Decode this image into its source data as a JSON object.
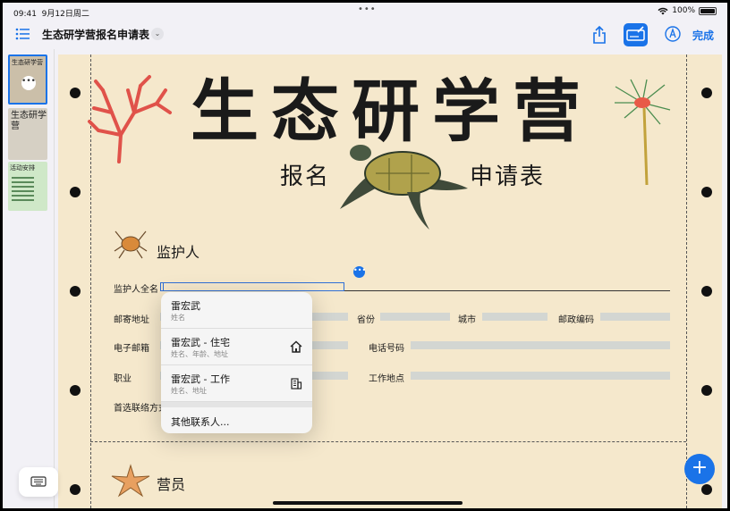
{
  "status": {
    "time": "09:41",
    "date": "9月12日周二",
    "battery": "100%"
  },
  "toolbar": {
    "title": "生态研学营报名申请表",
    "done_label": "完成"
  },
  "sidebar": {
    "thumbs": [
      {
        "label": "生态研学营"
      },
      {
        "label": "生态研学营"
      },
      {
        "label": "活动安排"
      }
    ]
  },
  "doc": {
    "title": "生态研学营",
    "subtitle_left": "报名",
    "subtitle_right": "申请表",
    "guardian": {
      "heading": "监护人",
      "full_name": "监护人全名",
      "mailing_address": "邮寄地址",
      "province": "省份",
      "city": "城市",
      "postal_code": "邮政编码",
      "email": "电子邮箱",
      "phone": "电话号码",
      "occupation": "职业",
      "workplace": "工作地点",
      "preferred_contact": "首选联络方式"
    },
    "camper": {
      "heading": "营员"
    }
  },
  "autofill": {
    "items": [
      {
        "name": "雷宏武",
        "detail": "姓名",
        "icon": "none"
      },
      {
        "name": "雷宏武 - 住宅",
        "detail": "姓名、年龄、地址",
        "icon": "house-icon"
      },
      {
        "name": "雷宏武 - 工作",
        "detail": "姓名、地址",
        "icon": "building-icon"
      }
    ],
    "other_label": "其他联系人..."
  },
  "colors": {
    "accent": "#1a73e8",
    "paper": "#f5e8cc",
    "field": "#d3d6d2"
  }
}
